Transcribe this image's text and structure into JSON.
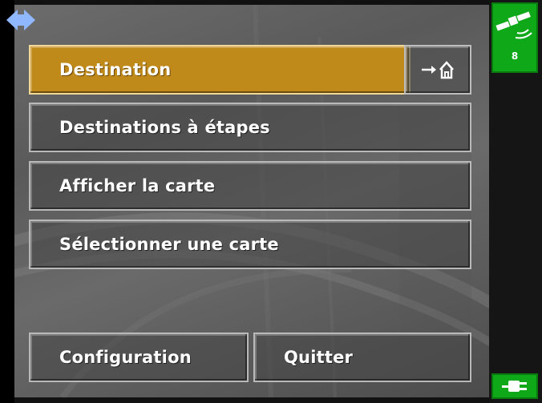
{
  "menu": {
    "destination_label": "Destination",
    "waypoints_label": "Destinations à étapes",
    "show_map_label": "Afficher la carte",
    "select_map_label": "Sélectionner une carte",
    "configuration_label": "Configuration",
    "quit_label": "Quitter"
  },
  "status": {
    "satellite_count": "8"
  },
  "icons": {
    "nav": "navigation-arrows-icon",
    "home": "arrow-home-icon",
    "satellite": "satellite-icon",
    "power": "power-plug-icon"
  },
  "colors": {
    "active_button": "#c08a1a",
    "status_green": "#0fa818"
  }
}
